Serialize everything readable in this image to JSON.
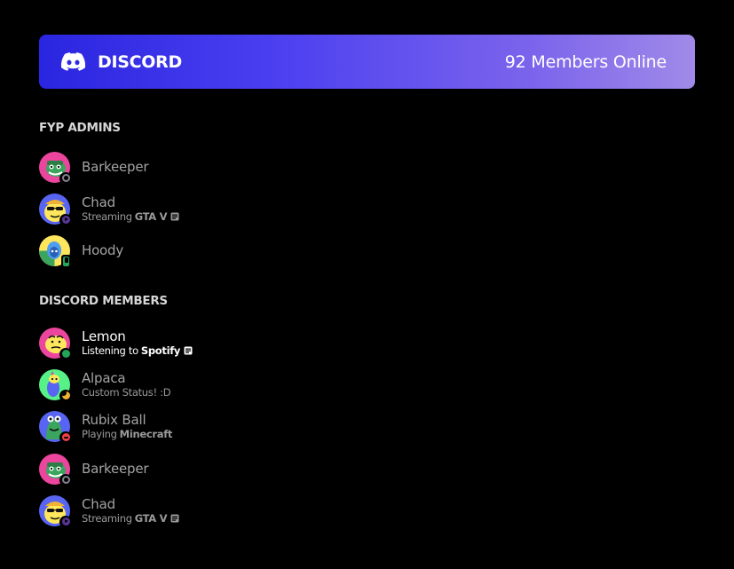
{
  "header": {
    "brand_label": "DISCORD",
    "brand_icon": "discord-logo-icon",
    "online_label": "92 Members Online",
    "gradient_start": "#2a25e0",
    "gradient_end": "#a08ae8"
  },
  "sections": [
    {
      "title": "FYP ADMINS",
      "members": [
        {
          "name": "Barkeeper",
          "status": "offline",
          "avatar": "green-monster-avatar",
          "activity_prefix": "",
          "activity_name": ""
        },
        {
          "name": "Chad",
          "status": "streaming",
          "avatar": "yellow-sunglasses-avatar",
          "activity_prefix": "Streaming",
          "activity_name": "GTA V"
        },
        {
          "name": "Hoody",
          "status": "mobile",
          "avatar": "blue-hoodie-avatar",
          "activity_prefix": "",
          "activity_name": ""
        }
      ]
    },
    {
      "title": "DISCORD MEMBERS",
      "members": [
        {
          "name": "Lemon",
          "status": "online",
          "avatar": "lemon-avatar",
          "activity_prefix": "Listening to",
          "activity_name": "Spotify"
        },
        {
          "name": "Alpaca",
          "status": "idle",
          "avatar": "alpaca-avatar",
          "activity_prefix": "Custom Status! :D",
          "activity_name": ""
        },
        {
          "name": "Rubix Ball",
          "status": "dnd",
          "avatar": "green-creature-avatar",
          "activity_prefix": "Playing",
          "activity_name": "Minecraft"
        },
        {
          "name": "Barkeeper",
          "status": "offline",
          "avatar": "green-monster-avatar",
          "activity_prefix": "",
          "activity_name": ""
        },
        {
          "name": "Chad",
          "status": "streaming",
          "avatar": "yellow-sunglasses-avatar",
          "activity_prefix": "Streaming",
          "activity_name": "GTA V"
        }
      ]
    }
  ],
  "colors": {
    "online": "#23a55a",
    "idle": "#f0b232",
    "dnd": "#f23f43",
    "offline": "#80848e",
    "streaming": "#593695"
  }
}
